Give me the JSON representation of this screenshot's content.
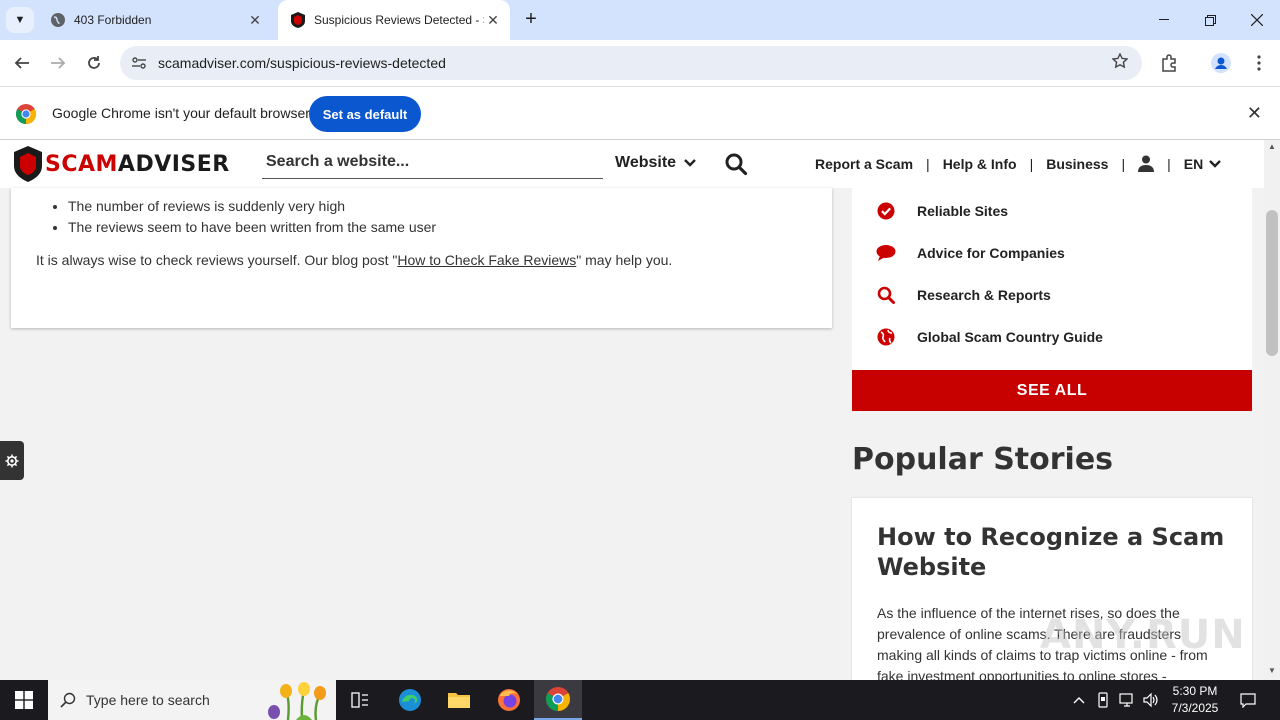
{
  "browser": {
    "tabs": [
      {
        "title": "403 Forbidden",
        "active": false
      },
      {
        "title": "Suspicious Reviews Detected - S",
        "active": true
      }
    ],
    "url": "scamadviser.com/suspicious-reviews-detected",
    "infobar": {
      "message": "Google Chrome isn't your default browser",
      "button": "Set as default"
    }
  },
  "site": {
    "logo": {
      "scam": "SCAM",
      "adviser": "ADVISER"
    },
    "search_placeholder": "Search a website...",
    "search_type": "Website",
    "nav": [
      "Report a Scam",
      "Help & Info",
      "Business",
      "EN"
    ],
    "nav_separator": "|"
  },
  "article": {
    "bullets": [
      "The number of reviews is suddenly very high",
      "The reviews seem to have been written from the same user"
    ],
    "para_before": "It is always wise to check reviews yourself. Our blog post \"",
    "para_link": "How to Check Fake Reviews",
    "para_after": "\" may help you."
  },
  "sidebar": {
    "items": [
      {
        "label": "Reliable Sites",
        "icon": "check-circle-icon"
      },
      {
        "label": "Advice for Companies",
        "icon": "speech-bubble-icon"
      },
      {
        "label": "Research & Reports",
        "icon": "search-icon"
      },
      {
        "label": "Global Scam Country Guide",
        "icon": "globe-icon"
      }
    ],
    "see_all": "SEE ALL"
  },
  "popular": {
    "heading": "Popular Stories",
    "story_title": "How to Recognize a Scam Website",
    "story_body": "As the influence of the internet rises, so does the prevalence of online scams. There are fraudsters making all kinds of claims to trap victims online - from fake investment opportunities to online stores -"
  },
  "watermark": "ANY.RUN",
  "taskbar": {
    "search_placeholder": "Type here to search",
    "time": "5:30 PM",
    "date": "7/3/2025"
  },
  "colors": {
    "brand_red": "#c70000",
    "chrome_blue": "#0b57d0",
    "tabstrip": "#d3e3fd"
  }
}
